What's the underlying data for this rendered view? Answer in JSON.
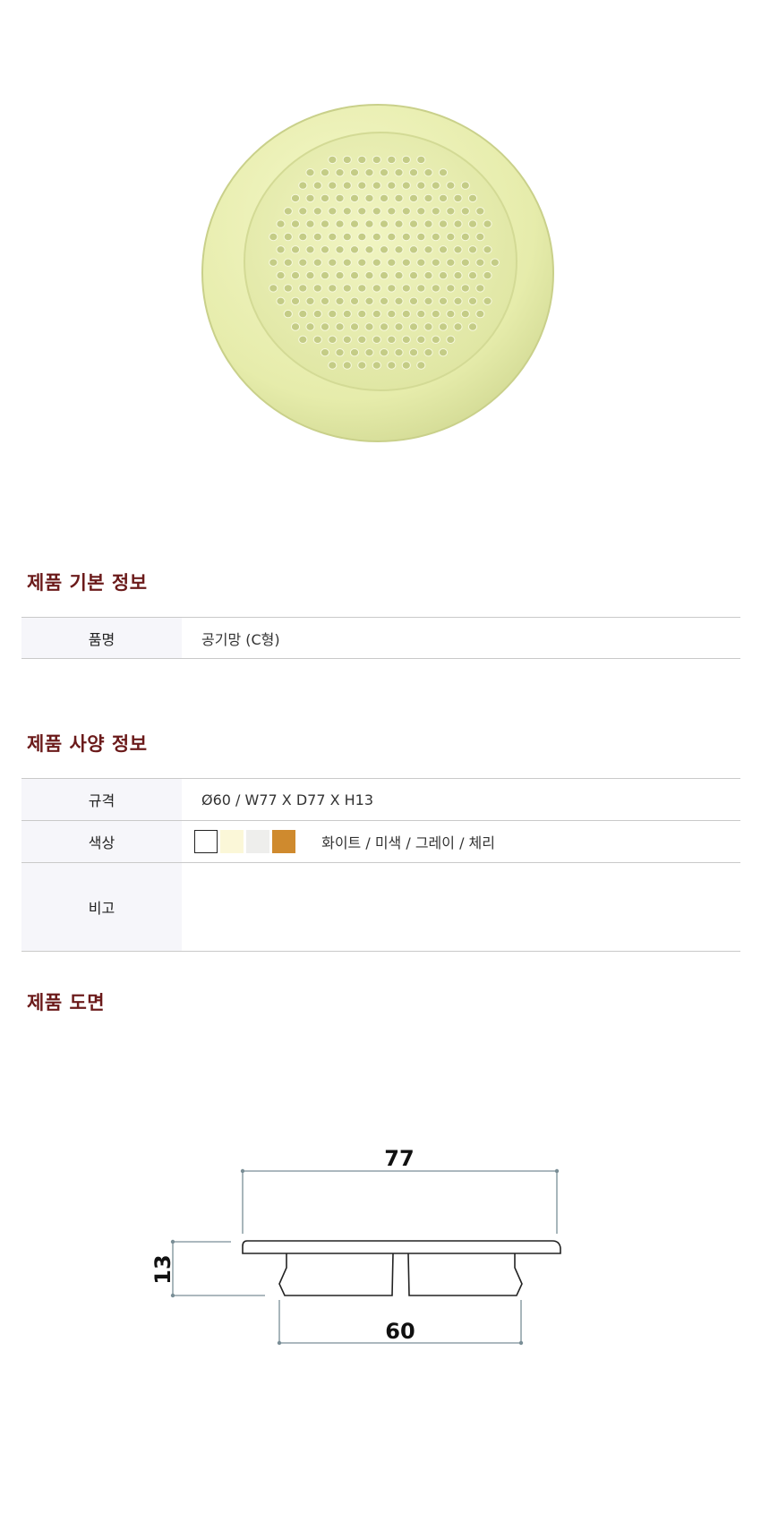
{
  "basic_info": {
    "title": "제품 기본 정보",
    "rows": [
      {
        "label": "품명",
        "value": "공기망 (C형)"
      }
    ]
  },
  "spec_info": {
    "title": "제품 사양 정보",
    "size_label": "규격",
    "size_value": "Ø60 / W77 X D77 X H13",
    "color_label": "색상",
    "swatches": [
      {
        "color": "#ffffff",
        "border": "#222222"
      },
      {
        "color": "#fbf7d8",
        "border": "#fbf7d8"
      },
      {
        "color": "#eeeeec",
        "border": "#eeeeec"
      },
      {
        "color": "#cf8a2e",
        "border": "#cf8a2e"
      }
    ],
    "color_names": "화이트 / 미색 / 그레이 / 체리",
    "note_label": "비고",
    "note_value": ""
  },
  "drawing": {
    "title": "제품 도면",
    "width_dim": "77",
    "height_dim": "13",
    "diameter_dim": "60"
  }
}
